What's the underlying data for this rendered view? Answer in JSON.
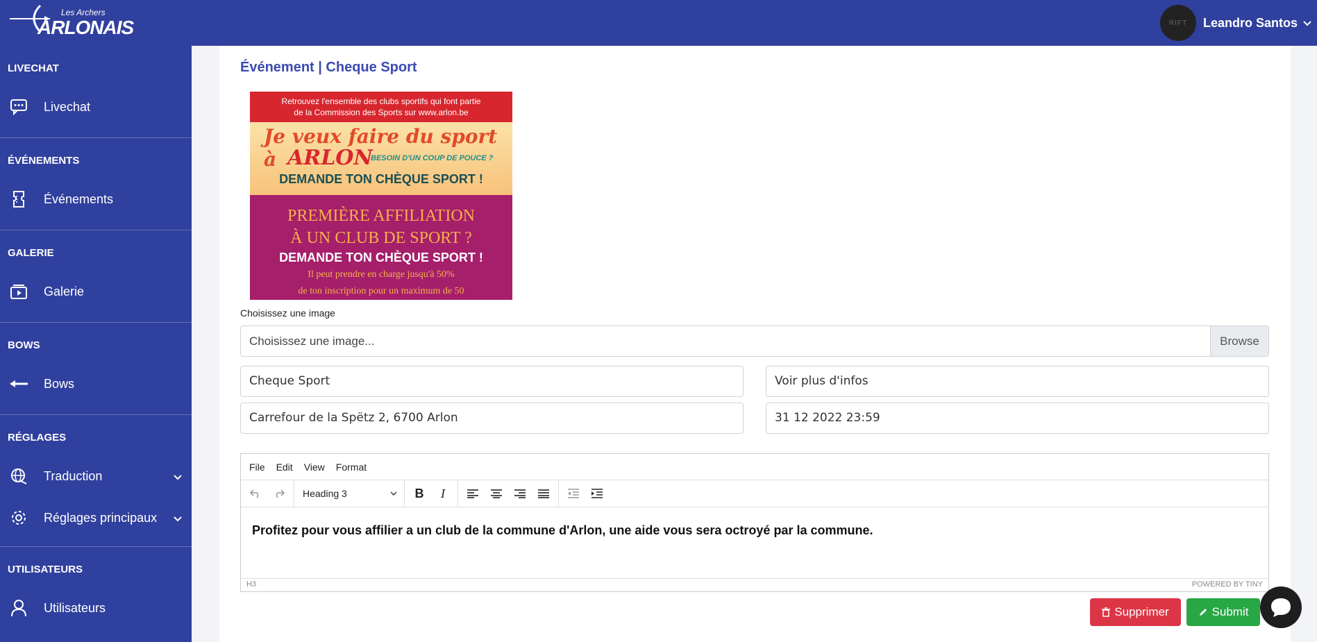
{
  "header": {
    "logo_small": "Les Archers",
    "logo_big": "ARLONAIS",
    "avatar_text": "RIFT",
    "user_name": "Leandro Santos"
  },
  "sidebar": {
    "sections": [
      {
        "title": "LIVECHAT",
        "items": [
          {
            "label": "Livechat",
            "icon": "chat-icon"
          }
        ]
      },
      {
        "title": "ÉVÉNEMENTS",
        "items": [
          {
            "label": "Événements",
            "icon": "ticket-icon"
          }
        ]
      },
      {
        "title": "GALERIE",
        "items": [
          {
            "label": "Galerie",
            "icon": "video-icon"
          }
        ]
      },
      {
        "title": "BOWS",
        "items": [
          {
            "label": "Bows",
            "icon": "arrow-left-icon"
          }
        ]
      },
      {
        "title": "RÉGLAGES",
        "items": [
          {
            "label": "Traduction",
            "icon": "globe-icon"
          },
          {
            "label": "Réglages principaux",
            "icon": "gear-icon"
          }
        ]
      },
      {
        "title": "UTILISATEURS",
        "items": [
          {
            "label": "Utilisateurs",
            "icon": "user-icon"
          }
        ]
      }
    ]
  },
  "main": {
    "title": "Événement | Cheque Sport",
    "poster": {
      "line1": "Retrouvez l'ensemble des clubs sportifs qui font partie",
      "line2": "de la Commission des Sports sur www.arlon.be",
      "headline1": "Je veux faire du sport à",
      "headline2": "ARLON",
      "tagline": "BESOIN D'UN COUP DE POUCE ?",
      "cta1": "DEMANDE TON CHÈQUE SPORT !",
      "question1": "PREMIÈRE AFFILIATION",
      "question2": "À UN CLUB DE SPORT ?",
      "cta2": "DEMANDE TON CHÈQUE SPORT !",
      "note1": "Il peut prendre en charge jusqu'à 50%",
      "note2": "de ton inscription pour un maximum de 50"
    },
    "file_label": "Choisissez une image",
    "file_placeholder": "Choisissez une image...",
    "browse_label": "Browse",
    "fields": {
      "title": "Cheque Sport",
      "link_text": "Voir plus d'infos",
      "address": "Carrefour de la Spëtz 2, 6700 Arlon",
      "date": "31 12 2022 23:59"
    },
    "editor": {
      "menu": [
        "File",
        "Edit",
        "View",
        "Format"
      ],
      "block_format": "Heading 3",
      "content": "Profitez pour vous affilier a un club de la commune d'Arlon, une aide vous sera octroyé par la commune.",
      "path": "H3",
      "powered": "POWERED BY TINY"
    },
    "buttons": {
      "delete": "Supprimer",
      "submit": "Submit"
    }
  },
  "colors": {
    "brand": "#30409e",
    "danger": "#dc3545",
    "success": "#28a745"
  }
}
